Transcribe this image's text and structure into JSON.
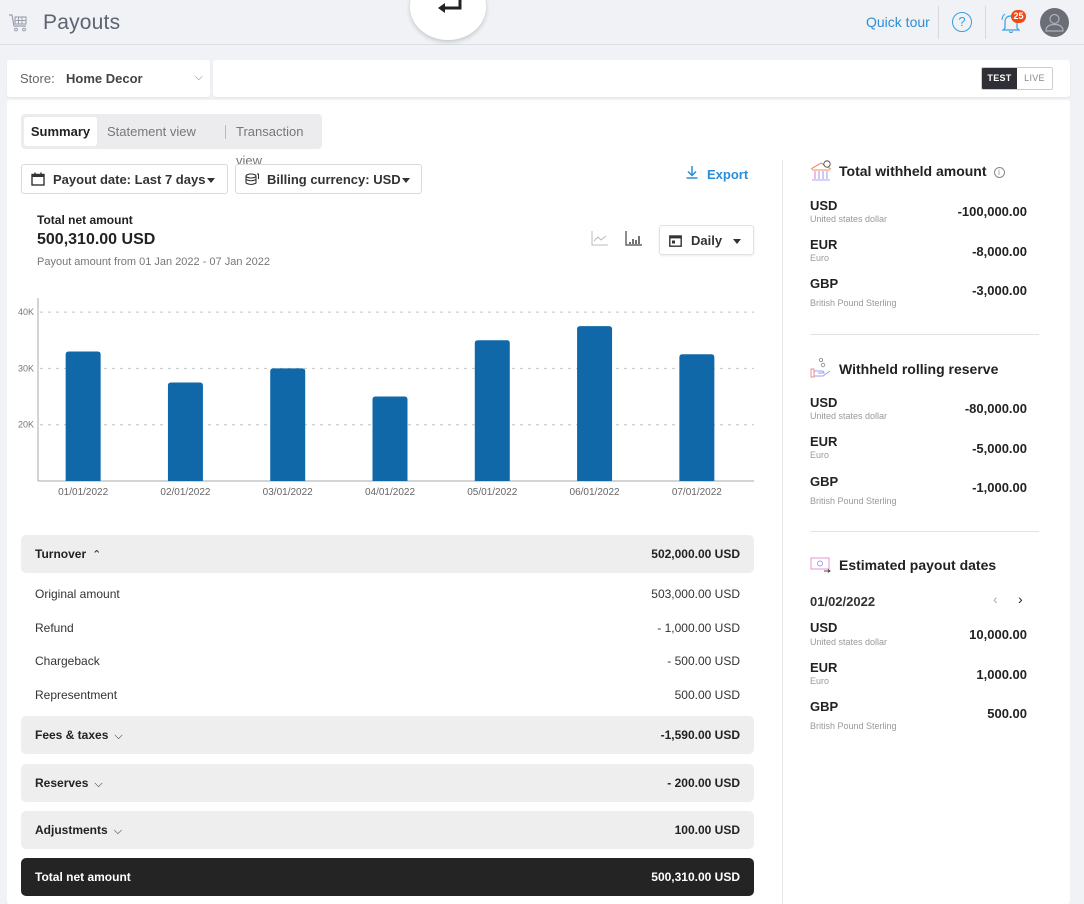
{
  "header": {
    "title": "Payouts",
    "quick_tour": "Quick tour",
    "help": "?",
    "notifications_count": "25"
  },
  "store": {
    "label": "Store:",
    "value": "Home Decor"
  },
  "environment": {
    "options": [
      "TEST",
      "LIVE"
    ],
    "selected": "TEST"
  },
  "tabs": [
    {
      "label": "Summary",
      "active": true
    },
    {
      "label": "Statement view",
      "active": false
    },
    {
      "label": "Transaction view",
      "active": false
    }
  ],
  "filters": {
    "payout_date": "Payout date: Last 7 days",
    "billing_currency": "Billing currency: USD",
    "export": "Export"
  },
  "summary": {
    "label": "Total net amount",
    "value": "500,310.00 USD",
    "subtitle": "Payout amount from 01 Jan 2022 - 07 Jan 2022",
    "granularity": "Daily"
  },
  "chart_data": {
    "type": "bar",
    "title": "",
    "xlabel": "",
    "ylabel": "",
    "categories": [
      "01/01/2022",
      "02/01/2022",
      "03/01/2022",
      "04/01/2022",
      "05/01/2022",
      "06/01/2022",
      "07/01/2022"
    ],
    "values": [
      33000,
      27500,
      30000,
      25000,
      35000,
      37500,
      32500
    ],
    "ylim": [
      10000,
      42500
    ],
    "yticks": [
      20000,
      30000,
      40000
    ],
    "ytick_labels": [
      "20K",
      "30K",
      "40K"
    ],
    "grid": true,
    "bar_color": "#1068a8"
  },
  "breakdown": {
    "turnover": {
      "label": "Turnover",
      "value": "502,000.00 USD",
      "expanded": true,
      "items": [
        {
          "label": "Original amount",
          "value": "503,000.00 USD"
        },
        {
          "label": "Refund",
          "value": "- 1,000.00 USD"
        },
        {
          "label": "Chargeback",
          "value": "- 500.00 USD"
        },
        {
          "label": "Representment",
          "value": "500.00 USD"
        }
      ]
    },
    "fees": {
      "label": "Fees & taxes",
      "value": "-1,590.00 USD"
    },
    "reserves": {
      "label": "Reserves",
      "value": "- 200.00 USD"
    },
    "adjustments": {
      "label": "Adjustments",
      "value": "100.00 USD"
    },
    "total": {
      "label": "Total net amount",
      "value": "500,310.00 USD"
    }
  },
  "withheld": {
    "title": "Total withheld amount",
    "rows": [
      {
        "code": "USD",
        "name": "United states dollar",
        "value": "-100,000.00"
      },
      {
        "code": "EUR",
        "name": "Euro",
        "value": "-8,000.00"
      },
      {
        "code": "GBP",
        "name": "British Pound Sterling",
        "value": "-3,000.00"
      }
    ]
  },
  "rolling_reserve": {
    "title": "Withheld rolling reserve",
    "rows": [
      {
        "code": "USD",
        "name": "United states dollar",
        "value": "-80,000.00"
      },
      {
        "code": "EUR",
        "name": "Euro",
        "value": "-5,000.00"
      },
      {
        "code": "GBP",
        "name": "British Pound Sterling",
        "value": "-1,000.00"
      }
    ]
  },
  "estimated": {
    "title": "Estimated payout dates",
    "date": "01/02/2022",
    "rows": [
      {
        "code": "USD",
        "name": "United states dollar",
        "value": "10,000.00"
      },
      {
        "code": "EUR",
        "name": "Euro",
        "value": "1,000.00"
      },
      {
        "code": "GBP",
        "name": "British Pound Sterling",
        "value": "500.00"
      }
    ]
  },
  "colors": {
    "accent": "#2a8fd6",
    "bar": "#1068a8",
    "badge": "#ee4a16",
    "total_bg": "#242424"
  }
}
